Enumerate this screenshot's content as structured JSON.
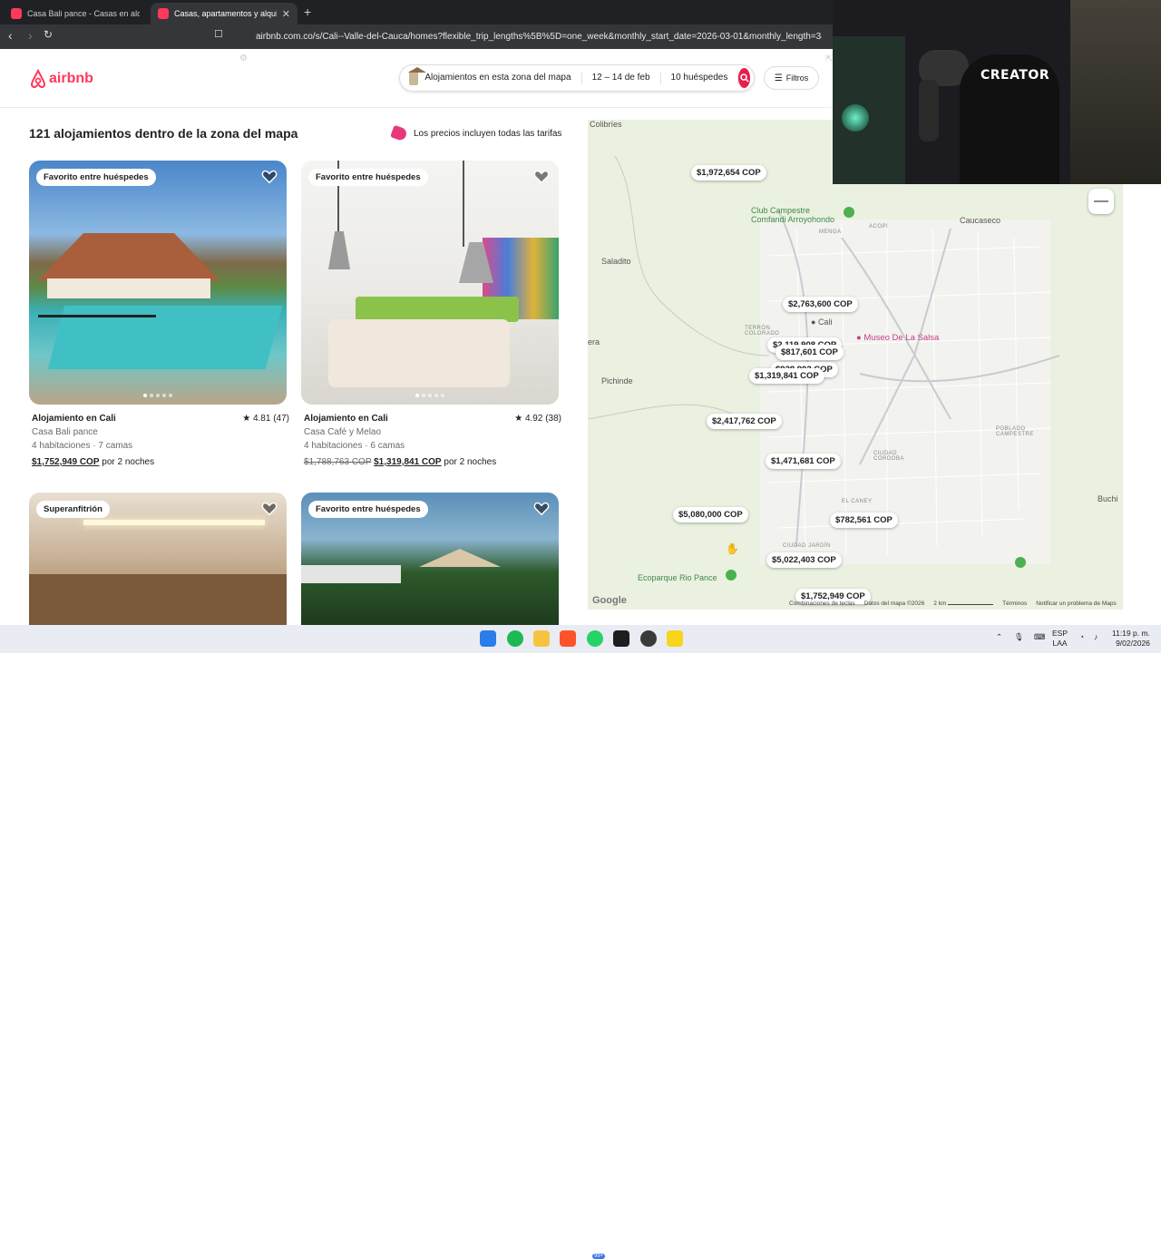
{
  "browser": {
    "tabs": [
      {
        "title": "Casa Bali pance - Casas en alquiler en Cali",
        "active": false
      },
      {
        "title": "Casas, apartamentos y alquileres de temporada",
        "active": true
      }
    ],
    "url": "airbnb.com.co/s/Cali--Valle-del-Cauca/homes?flexible_trip_lengths%5B%5D=one_week&monthly_start_date=2026-03-01&monthly_length=3&mont..."
  },
  "header": {
    "logo": "airbnb",
    "search": {
      "location": "Alojamientos en esta zona del mapa",
      "dates": "12 – 14 de feb",
      "guests": "10 huéspedes"
    },
    "filters_label": "Filtros"
  },
  "results": {
    "title": "121 alojamientos dentro de la zona del mapa",
    "price_note": "Los precios incluyen todas las tarifas"
  },
  "listings": [
    {
      "badge": "Favorito entre huéspedes",
      "location": "Alojamiento en Cali",
      "rating": "4.81 (47)",
      "name": "Casa Bali pance",
      "details": "4 habitaciones · 7 camas",
      "price": "$1,752,949 COP",
      "old_price": "",
      "price_suffix": "por 2 noches"
    },
    {
      "badge": "Favorito entre huéspedes",
      "location": "Alojamiento en Cali",
      "rating": "4.92 (38)",
      "name": "Casa Café y Melao",
      "details": "4 habitaciones · 6 camas",
      "price": "$1,319,841 COP",
      "old_price": "$1,788,763 COP",
      "price_suffix": "por 2 noches"
    },
    {
      "badge": "Superanfitrión"
    },
    {
      "badge": "Favorito entre huéspedes"
    }
  ],
  "map": {
    "pins": [
      "$1,972,654 COP",
      "$2,763,600 COP",
      "$2,119,908 COP",
      "$817,601 COP",
      "$928,902 COP",
      "$1,319,841 COP",
      "$2,417,762 COP",
      "$1,471,681 COP",
      "$5,080,000 COP",
      "$782,561 COP",
      "$5,022,403 COP",
      "$1,752,949 COP"
    ],
    "labels": {
      "colibries": "Colibríes",
      "club": "Club Campestre\nComfandi Arroyohondo",
      "acopi": "ACOPI",
      "menga": "MENGA",
      "caucaseco": "Caucaseco",
      "saladito": "Saladito",
      "cali": "Cali",
      "terron": "TERRÓN\nCOLORADO",
      "museo": "Museo De La Salsa",
      "era": "era",
      "pichinde": "Pichinde",
      "poblado": "POBLADO\nCAMPESTRE",
      "cordoba": "CIUDAD\nCÓRDOBA",
      "caney": "EL CANEY",
      "buchi": "Buchi",
      "jardin": "CIUDAD JARDÍN",
      "ecoparque": "Ecoparque Rio Pance"
    },
    "footer": [
      "Combinaciones de teclas",
      "Datos del mapa ©2026",
      "2 km",
      "Términos",
      "Notificar un problema de Maps"
    ],
    "google": "Google",
    "zoom_out": "—"
  },
  "webcam": {
    "shirt_text": "CREATOR"
  },
  "taskbar": {
    "lang": "ESP\nLAA",
    "time": "11:19 p. m.",
    "date": "9/02/2026",
    "badge": "99+"
  },
  "colors": {
    "brand": "#ff385c",
    "search_button": "#e61e4d"
  }
}
